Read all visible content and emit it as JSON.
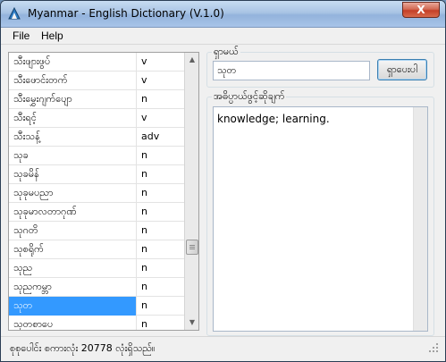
{
  "window": {
    "title": "Myanmar - English Dictionary (V.1.0)",
    "close_label": "X"
  },
  "menu": {
    "items": [
      "File",
      "Help"
    ]
  },
  "wordlist": {
    "rows": [
      {
        "word": "သီးဖျားဖွပ်",
        "pos": "v"
      },
      {
        "word": "သီးဖောင်းတက်",
        "pos": "v"
      },
      {
        "word": "သီးမွှေးဂျက်ပျော",
        "pos": "n"
      },
      {
        "word": "သီးရင့်",
        "pos": "v"
      },
      {
        "word": "သီးသန့်",
        "pos": "adv"
      },
      {
        "word": "သုခ",
        "pos": "n"
      },
      {
        "word": "သုခမိန်",
        "pos": "n"
      },
      {
        "word": "သုခုမပညာ",
        "pos": "n"
      },
      {
        "word": "သုခုမာလတာဂုဏ်",
        "pos": "n"
      },
      {
        "word": "သုဂတိ",
        "pos": "n"
      },
      {
        "word": "သုစရိုက်",
        "pos": "n"
      },
      {
        "word": "သုည",
        "pos": "n"
      },
      {
        "word": "သုညကမ္ဘာ",
        "pos": "n"
      },
      {
        "word": "သုတ",
        "pos": "n",
        "selected": true
      },
      {
        "word": "သုတစာပေ",
        "pos": "n"
      }
    ],
    "scroll_up_icon": "up-arrow-icon",
    "scroll_down_icon": "down-arrow-icon"
  },
  "search": {
    "group_label": "ရှာမယ်",
    "value": "သုတ",
    "button_label": "ရှာပေးပါ"
  },
  "definition": {
    "group_label": "အဓိပ္ပာယ်ဖွင့်ဆိုချက်",
    "text": "knowledge; learning."
  },
  "status": {
    "text": "စုစုပေါင်း စကားလုံး  20778 လုံးရှိသည်။"
  },
  "colors": {
    "selection": "#3399ff",
    "accent_border": "#3c7fb1"
  }
}
